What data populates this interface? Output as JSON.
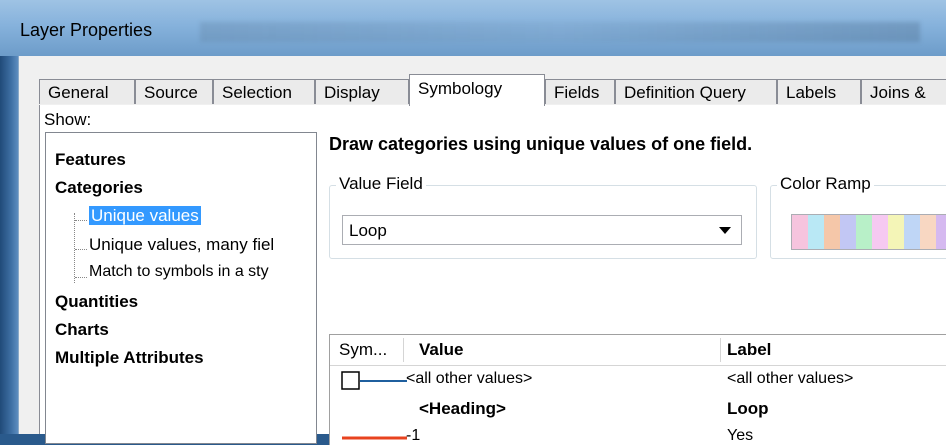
{
  "window": {
    "title": "Layer Properties"
  },
  "tabs": [
    {
      "label": "General"
    },
    {
      "label": "Source"
    },
    {
      "label": "Selection"
    },
    {
      "label": "Display"
    },
    {
      "label": "Symbology",
      "active": true
    },
    {
      "label": "Fields"
    },
    {
      "label": "Definition Query"
    },
    {
      "label": "Labels"
    },
    {
      "label": "Joins &"
    }
  ],
  "show": {
    "label": "Show:",
    "items": [
      {
        "label": "Features",
        "level": 0
      },
      {
        "label": "Categories",
        "level": 0
      },
      {
        "label": "Unique values",
        "level": 1,
        "selected": true
      },
      {
        "label": "Unique values, many fiel",
        "level": 1
      },
      {
        "label": "Match to symbols in a sty",
        "level": 1
      },
      {
        "label": "Quantities",
        "level": 0
      },
      {
        "label": "Charts",
        "level": 0
      },
      {
        "label": "Multiple Attributes",
        "level": 0
      }
    ]
  },
  "description": "Draw categories using unique values of one field.",
  "value_field": {
    "legend": "Value Field",
    "value": "Loop"
  },
  "color_ramp": {
    "legend": "Color Ramp",
    "colors": [
      "#f6c4de",
      "#b9e8f5",
      "#f5c7a9",
      "#c2c7f4",
      "#b8f0c8",
      "#f6c9f1",
      "#f4f5b7",
      "#bfd6f6",
      "#f8d7c2",
      "#d5b9f0"
    ]
  },
  "table": {
    "headers": {
      "symbol": "Sym...",
      "value": "Value",
      "label": "Label"
    },
    "rows": [
      {
        "symbol": "box-line",
        "symbol_color": "#1f5f9e",
        "value": "<all other values>",
        "label": "<all other values>",
        "bold": false
      },
      {
        "symbol": "none",
        "value": "<Heading>",
        "label": "Loop",
        "bold": true
      },
      {
        "symbol": "line",
        "symbol_color": "#e8431f",
        "value": "-1",
        "label": "Yes",
        "bold": false
      }
    ]
  },
  "colors": {
    "selection": "#3399ff",
    "titlebar": "#86b2dc"
  }
}
